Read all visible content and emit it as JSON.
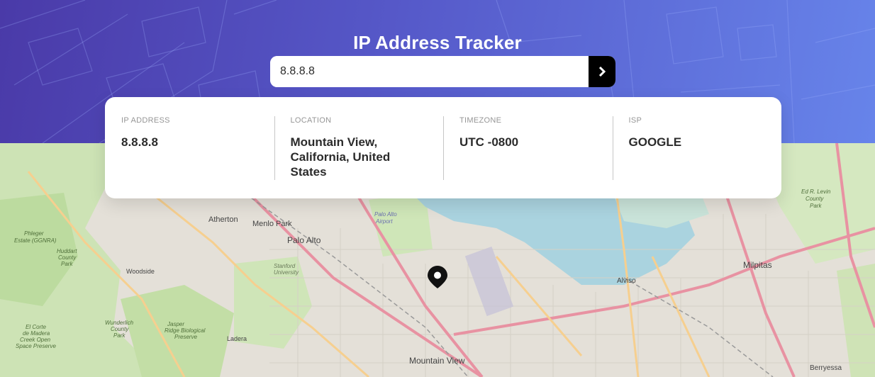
{
  "header": {
    "title": "IP Address Tracker"
  },
  "search": {
    "value": "8.8.8.8",
    "submit_icon": "chevron-right-icon"
  },
  "info": [
    {
      "label": "IP ADDRESS",
      "value": "8.8.8.8"
    },
    {
      "label": "LOCATION",
      "value": "Mountain View, California, United States"
    },
    {
      "label": "TIMEZONE",
      "value": "UTC -0800"
    },
    {
      "label": "ISP",
      "value": "GOOGLE"
    }
  ],
  "map": {
    "labels": [
      "Atherton",
      "Menlo Park",
      "Palo Alto",
      "Stanford University",
      "Palo Alto Airport",
      "Woodside",
      "Alviso",
      "Milpitas",
      "Mountain View",
      "Berryessa",
      "Ladera",
      "Jasper Ridge Biological Preserve",
      "Huddart County Park",
      "Phleger Estate (GGNRA)",
      "Wunderlich County Park",
      "El Corte de Madera Creek Open Space Preserve",
      "Ed R. Levin County Park"
    ],
    "marker_icon": "location-pin-icon",
    "colors": {
      "water": "#aad3df",
      "park": "#c8e0b0",
      "urban": "#e2ded6",
      "road": "#e892a2"
    }
  }
}
